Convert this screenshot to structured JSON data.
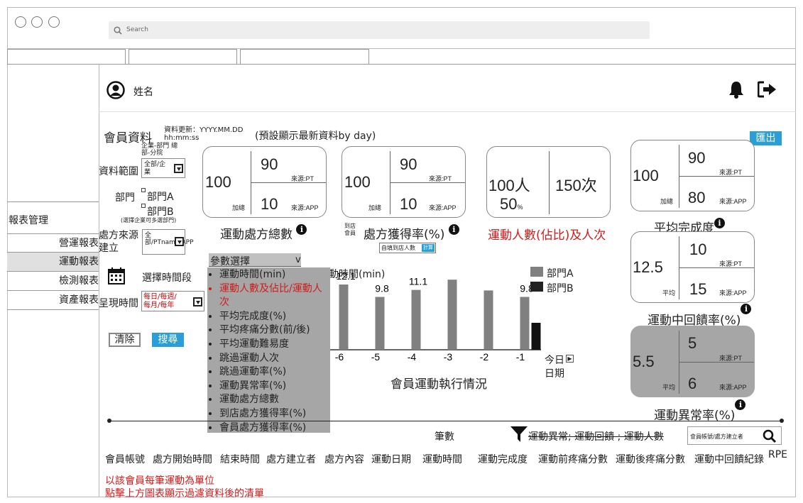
{
  "header": {
    "user_name": "姓名"
  },
  "search": {
    "placeholder": "Search"
  },
  "sidebar": {
    "title": "報表管理",
    "items": [
      {
        "label": "營運報表"
      },
      {
        "label": "運動報表"
      },
      {
        "label": "檢測報表"
      },
      {
        "label": "資產報表"
      }
    ]
  },
  "page": {
    "title": "會員資料",
    "update_label": "資料更新：YYYY.MM.DD hh:mm:ss",
    "update_note": "(預設顯示最新資料by day)",
    "export_label": "匯出"
  },
  "filters": {
    "range_label": "資料範圍",
    "range_note": "企業-部門 總部-分院",
    "range_value": "全部/企業",
    "dept_label": "部門",
    "dept_options": [
      "部門A",
      "部門B"
    ],
    "dept_note": "(選擇企業可多選部門)",
    "source_label": "處方來源建立",
    "source_value": "全部/PTname/APP",
    "period_label": "選擇時間段",
    "display_label": "呈現時間",
    "display_value": "每日/每週/每月/每年",
    "clear_label": "清除",
    "search_label": "搜尋"
  },
  "cards": {
    "total": {
      "main": "100",
      "main_sub": "加總",
      "top": "90",
      "top_src": "來源:PT",
      "bottom": "10",
      "bottom_src": "來源:APP",
      "title": "運動處方總數"
    },
    "rate": {
      "main": "100",
      "main_sub": "加總",
      "top": "90",
      "top_src": "來源:PT",
      "bottom": "10",
      "bottom_src": "來源:APP",
      "title": "處方獲得率(%)",
      "side_note": "到店會員",
      "button_label": "自填到店人數",
      "button_tag": "計算"
    },
    "people": {
      "left": "100人",
      "left_pct": "50",
      "left_pct_unit": "%",
      "right": "150次",
      "title": "運動人數(佔比)及人次"
    },
    "completion": {
      "main": "100",
      "main_sub": "加總",
      "top": "90",
      "top_src": "來源:PT",
      "bottom": "80",
      "bottom_src": "來源:APP",
      "title": "平均完成度"
    },
    "feedback": {
      "main": "12.5",
      "main_sub": "平均",
      "top": "10",
      "top_src": "來源:PT",
      "bottom": "15",
      "bottom_src": "來源:APP",
      "title": "運動中回饋率(%)"
    },
    "abnormal": {
      "main": "5.5",
      "main_sub": "平均",
      "top": "5",
      "top_src": "來源:PT",
      "bottom": "6",
      "bottom_src": "來源:APP",
      "title": "運動異常率(%)"
    }
  },
  "params": {
    "select_label": "參數選擇",
    "select_arrow": "v",
    "items": [
      "運動時間(min)",
      "運動人數及佔比/運動人次",
      "平均完成度(%)",
      "平均疼痛分數(前/後)",
      "平均運動難易度",
      "跳過運動人次",
      "跳過運動率(%)",
      "運動異常率(%)",
      "運動處方總數",
      "到店處方獲得率(%)",
      "會員處方獲得率(%)"
    ],
    "highlight_index": 1
  },
  "chart_data": {
    "type": "bar",
    "title": "會員運動執行情況",
    "ylabel": "運動時間(min)",
    "x_partial_label": "動時間(min)",
    "categories": [
      "-6",
      "-5",
      "-4",
      "-3",
      "-2",
      "-1"
    ],
    "series": [
      {
        "name": "部門A",
        "color": "#808080",
        "values": [
          12.1,
          9.8,
          11.1,
          13.0,
          11.0,
          9.8
        ]
      },
      {
        "name": "部門B",
        "color": "#111111",
        "values": [
          null,
          null,
          null,
          null,
          null,
          5.0
        ]
      }
    ],
    "value_labels": [
      "12.1",
      "9.8",
      "11.1",
      "",
      "",
      "9.8"
    ],
    "today_label": "今日",
    "date_label": "日期"
  },
  "table": {
    "count_label": "筆數",
    "filter_text": "運動異常; 運動回饋 ; 運動人數",
    "search_placeholder": "會員帳號/處方建立者",
    "columns": [
      "會員帳號",
      "處方開始時間",
      "結束時間",
      "處方建立者",
      "處方內容",
      "運動日期",
      "運動時間",
      "運動完成度",
      "運動前疼痛分數",
      "運動後疼痛分數",
      "運動中回饋紀錄",
      "RPE"
    ],
    "note1": "以該會員每筆運動為單位",
    "note2": "點擊上方圖表顯示過濾資料後的清單"
  }
}
